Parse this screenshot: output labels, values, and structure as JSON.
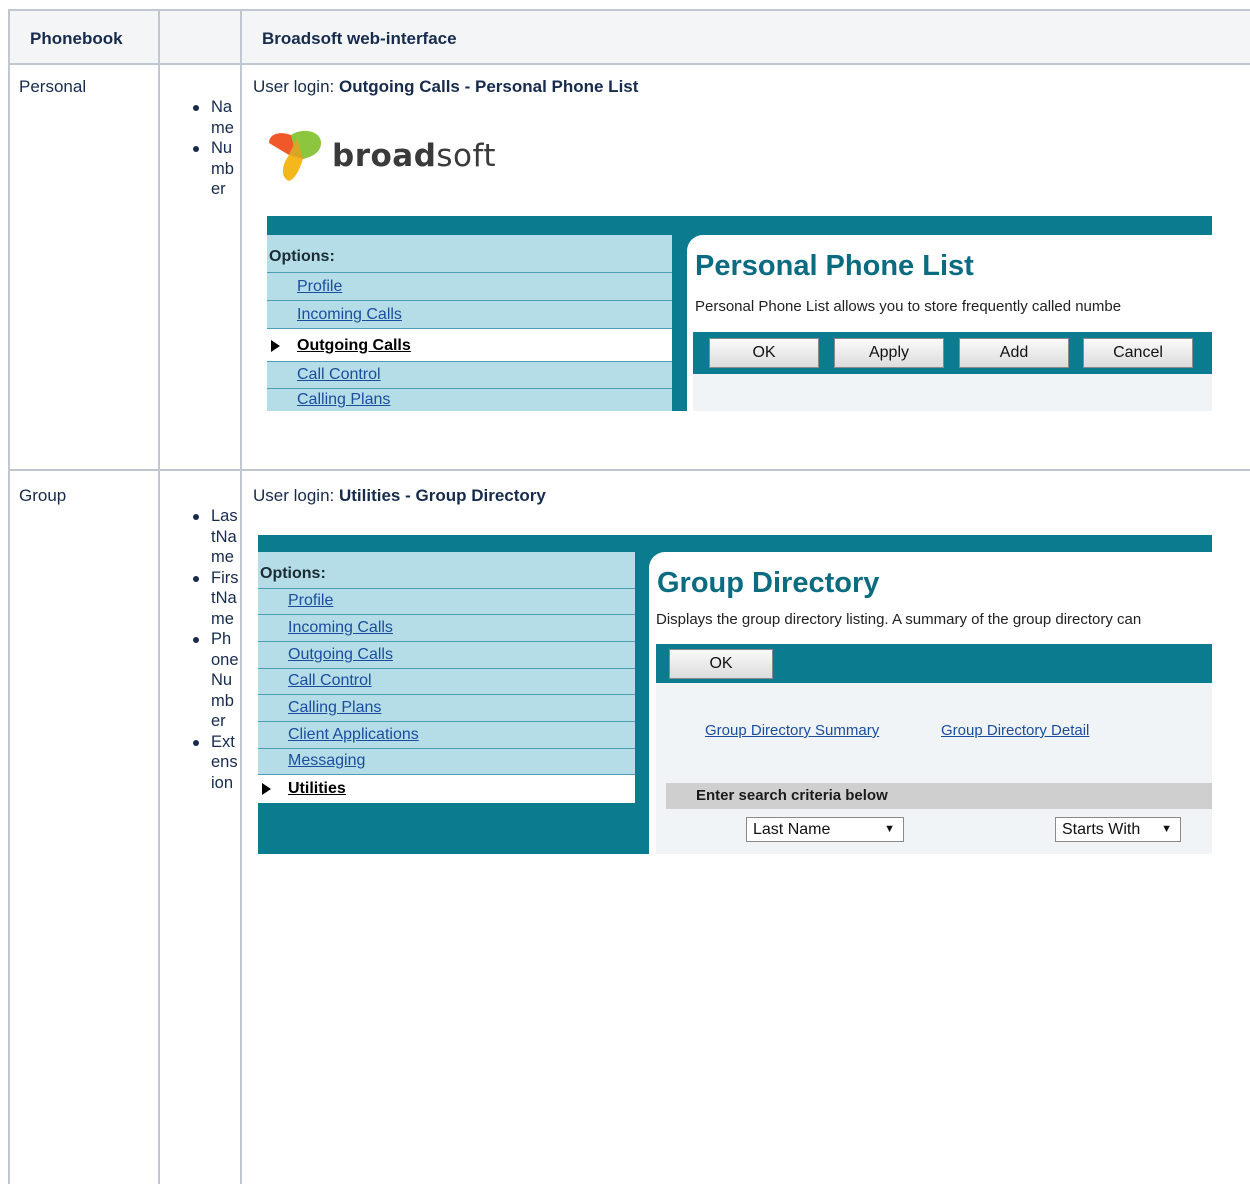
{
  "table": {
    "headers": [
      "Phonebook",
      "",
      "Broadsoft web-interface"
    ],
    "rows": [
      {
        "phonebook": "Personal",
        "fields": [
          "Name",
          "Number"
        ],
        "caption_prefix": "User login: ",
        "caption_bold": "Outgoing Calls - Personal Phone List"
      },
      {
        "phonebook": "Group",
        "fields": [
          "LastName",
          "FirstName",
          "PhoneNumber",
          "Extension"
        ],
        "caption_prefix": "User login: ",
        "caption_bold": "Utilities - Group Directory"
      }
    ]
  },
  "logo": {
    "bold": "broad",
    "light": "soft"
  },
  "personal_ui": {
    "options_title": "Options:",
    "options": [
      "Profile",
      "Incoming Calls",
      "Outgoing Calls",
      "Call Control",
      "Calling Plans"
    ],
    "active_option": "Outgoing Calls",
    "title": "Personal Phone List",
    "description": "Personal Phone List allows you to store frequently called numbe",
    "buttons": [
      "OK",
      "Apply",
      "Add",
      "Cancel"
    ]
  },
  "group_ui": {
    "options_title": "Options:",
    "options": [
      "Profile",
      "Incoming Calls",
      "Outgoing Calls",
      "Call Control",
      "Calling Plans",
      "Client Applications",
      "Messaging",
      "Utilities"
    ],
    "active_option": "Utilities",
    "title": "Group Directory",
    "description": "Displays the group directory listing. A summary of the group directory can",
    "buttons": [
      "OK"
    ],
    "links": [
      "Group Directory Summary",
      "Group Directory Detail"
    ],
    "search_label": "Enter search criteria below",
    "search_field_select": "Last Name",
    "search_mode_select": "Starts With"
  },
  "colors": {
    "teal": "#0b7b90",
    "options_bg": "#b5dde8",
    "title": "#0b6b80",
    "link": "#1a4d9e",
    "grid": "#c1c7d0"
  }
}
